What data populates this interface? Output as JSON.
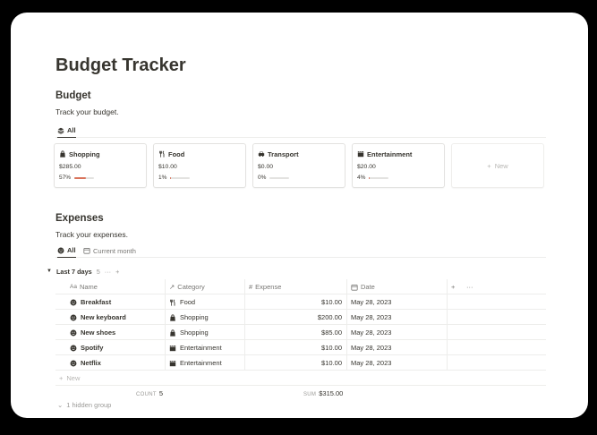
{
  "page": {
    "title": "Budget Tracker"
  },
  "budget": {
    "heading": "Budget",
    "description": "Track your budget.",
    "tab": "All",
    "cards": [
      {
        "title": "Shopping",
        "icon": "shopping-bag-icon",
        "amount": "$285.00",
        "percent": "57%",
        "progress": 0.57
      },
      {
        "title": "Food",
        "icon": "fork-knife-icon",
        "amount": "$10.00",
        "percent": "1%",
        "progress": 0.01
      },
      {
        "title": "Transport",
        "icon": "car-icon",
        "amount": "$0.00",
        "percent": "0%",
        "progress": 0
      },
      {
        "title": "Entertainment",
        "icon": "clapperboard-icon",
        "amount": "$20.00",
        "percent": "4%",
        "progress": 0.04
      }
    ],
    "new_label": "New"
  },
  "expenses": {
    "heading": "Expenses",
    "description": "Track your expenses.",
    "tabs": [
      "All",
      "Current month"
    ],
    "group": {
      "label": "Last 7 days",
      "count": "5"
    },
    "columns": {
      "name_prefix": "Aa",
      "name": "Name",
      "category": "Category",
      "expense": "Expense",
      "date": "Date"
    },
    "rows": [
      {
        "name": "Breakfast",
        "category": "Food",
        "category_icon": "fork-knife-icon",
        "expense": "$10.00",
        "date": "May 28, 2023"
      },
      {
        "name": "New keyboard",
        "category": "Shopping",
        "category_icon": "shopping-bag-icon",
        "expense": "$200.00",
        "date": "May 28, 2023"
      },
      {
        "name": "New shoes",
        "category": "Shopping",
        "category_icon": "shopping-bag-icon",
        "expense": "$85.00",
        "date": "May 28, 2023"
      },
      {
        "name": "Spotify",
        "category": "Entertainment",
        "category_icon": "clapperboard-icon",
        "expense": "$10.00",
        "date": "May 28, 2023"
      },
      {
        "name": "Netflix",
        "category": "Entertainment",
        "category_icon": "clapperboard-icon",
        "expense": "$10.00",
        "date": "May 28, 2023"
      }
    ],
    "new_label": "New",
    "summary": {
      "count_label": "COUNT",
      "count_value": "5",
      "sum_label": "SUM",
      "sum_value": "$315.00"
    },
    "hidden_group": "1 hidden group"
  },
  "colors": {
    "progress": "#d9735b",
    "text": "#37352f",
    "muted": "#787774",
    "border": "#ededeb"
  }
}
